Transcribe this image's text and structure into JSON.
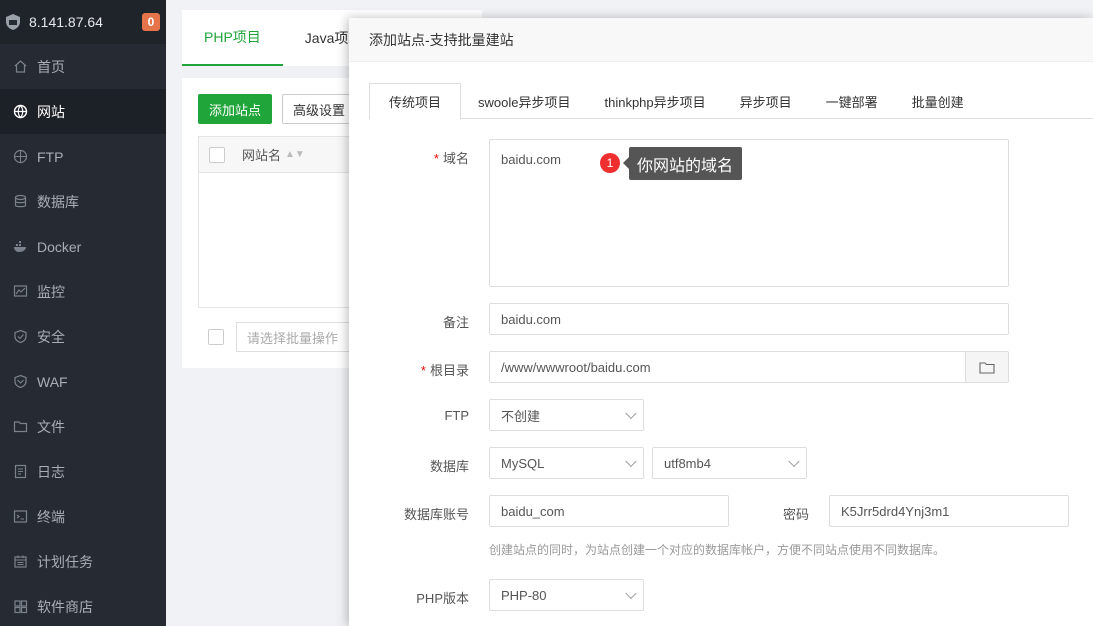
{
  "sidebar": {
    "server_ip": "8.141.87.64",
    "badge_count": "0",
    "items": [
      {
        "label": "首页",
        "icon": "home-icon"
      },
      {
        "label": "网站",
        "icon": "globe-icon"
      },
      {
        "label": "FTP",
        "icon": "ftp-icon"
      },
      {
        "label": "数据库",
        "icon": "database-icon"
      },
      {
        "label": "Docker",
        "icon": "docker-icon"
      },
      {
        "label": "监控",
        "icon": "monitor-icon"
      },
      {
        "label": "安全",
        "icon": "shield-icon"
      },
      {
        "label": "WAF",
        "icon": "waf-shield-icon"
      },
      {
        "label": "文件",
        "icon": "folder-icon"
      },
      {
        "label": "日志",
        "icon": "log-icon"
      },
      {
        "label": "终端",
        "icon": "terminal-icon"
      },
      {
        "label": "计划任务",
        "icon": "calendar-icon"
      },
      {
        "label": "软件商店",
        "icon": "store-icon"
      }
    ],
    "active_index": 1
  },
  "main": {
    "tabs": [
      "PHP项目",
      "Java项目"
    ],
    "add_site_button": "添加站点",
    "advanced_button": "高级设置",
    "table_col_site_name": "网站名",
    "batch_placeholder": "请选择批量操作"
  },
  "modal": {
    "title": "添加站点-支持批量建站",
    "tabs": [
      "传统项目",
      "swoole异步项目",
      "thinkphp异步项目",
      "异步项目",
      "一键部署",
      "批量创建"
    ],
    "domain": {
      "label": "域名",
      "value": "baidu.com"
    },
    "tooltip": {
      "number": "1",
      "text": "你网站的域名"
    },
    "remark": {
      "label": "备注",
      "value": "baidu.com"
    },
    "root_dir": {
      "label": "根目录",
      "value": "/www/wwwroot/baidu.com"
    },
    "ftp": {
      "label": "FTP",
      "value": "不创建"
    },
    "database": {
      "label": "数据库",
      "type": "MySQL",
      "charset": "utf8mb4"
    },
    "db_account": {
      "label": "数据库账号",
      "value": "baidu_com"
    },
    "db_password": {
      "label": "密码",
      "value": "K5Jrr5drd4Ynj3m1"
    },
    "db_hint": "创建站点的同时，为站点创建一个对应的数据库帐户，方便不同站点使用不同数据库。",
    "php_version": {
      "label": "PHP版本",
      "value": "PHP-80"
    }
  },
  "colors": {
    "accent": "#20a53a",
    "sidebar_bg": "#262b33",
    "badge": "#e6744b",
    "tooltip_marker": "#ef2f2f"
  }
}
